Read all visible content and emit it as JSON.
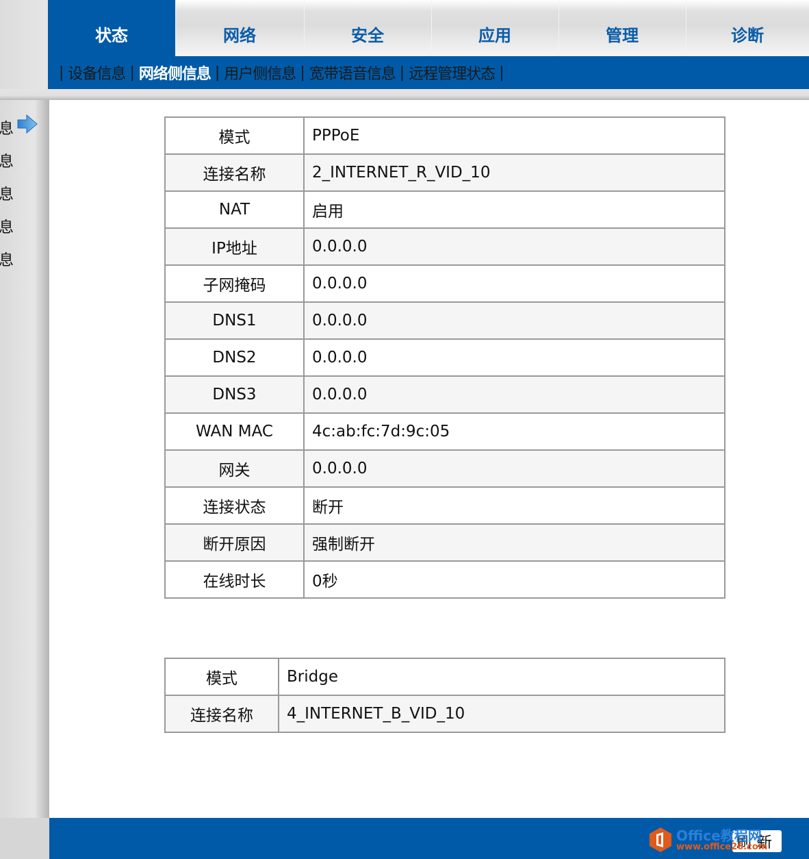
{
  "tabs": [
    {
      "label": "状态",
      "active": true
    },
    {
      "label": "网络",
      "active": false
    },
    {
      "label": "安全",
      "active": false
    },
    {
      "label": "应用",
      "active": false
    },
    {
      "label": "管理",
      "active": false
    },
    {
      "label": "诊断",
      "active": false
    }
  ],
  "subnav": {
    "separator": "|",
    "items": [
      {
        "label": "设备信息",
        "active": false
      },
      {
        "label": "网络侧信息",
        "active": true
      },
      {
        "label": "用户侧信息",
        "active": false
      },
      {
        "label": "宽带语音信息",
        "active": false
      },
      {
        "label": "远程管理状态",
        "active": false
      }
    ]
  },
  "sidebar": {
    "items": [
      "息",
      "息",
      "息",
      "息",
      "息"
    ],
    "current_indicator": "arrow-right-icon"
  },
  "table1": [
    {
      "key": "模式",
      "value": "PPPoE"
    },
    {
      "key": "连接名称",
      "value": "2_INTERNET_R_VID_10"
    },
    {
      "key": "NAT",
      "value": "启用"
    },
    {
      "key": "IP地址",
      "value": "0.0.0.0"
    },
    {
      "key": "子网掩码",
      "value": "0.0.0.0"
    },
    {
      "key": "DNS1",
      "value": "0.0.0.0"
    },
    {
      "key": "DNS2",
      "value": "0.0.0.0"
    },
    {
      "key": "DNS3",
      "value": "0.0.0.0"
    },
    {
      "key": "WAN MAC",
      "value": "4c:ab:fc:7d:9c:05"
    },
    {
      "key": "网关",
      "value": "0.0.0.0"
    },
    {
      "key": "连接状态",
      "value": "断开"
    },
    {
      "key": "断开原因",
      "value": "强制断开"
    },
    {
      "key": "在线时长",
      "value": "0秒"
    }
  ],
  "table2": [
    {
      "key": "模式",
      "value": "Bridge"
    },
    {
      "key": "连接名称",
      "value": "4_INTERNET_B_VID_10"
    }
  ],
  "footer": {
    "refresh_label": "刷新"
  },
  "watermark": {
    "line1": "Office教程网",
    "line2": "www.office26.com"
  },
  "colors": {
    "brand_blue": "#005aa7",
    "watermark_orange": "#e05a1c"
  }
}
